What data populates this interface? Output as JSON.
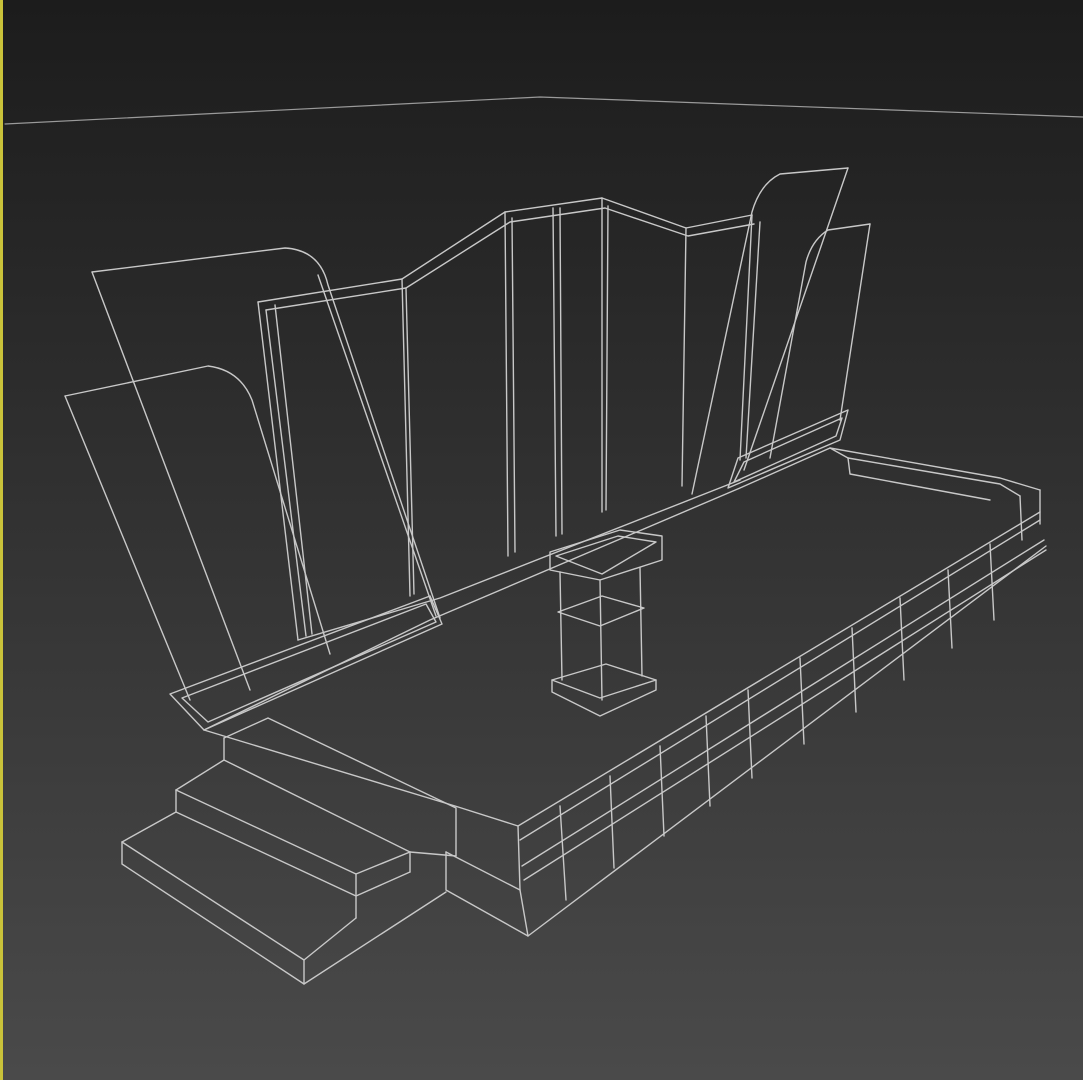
{
  "viewport": {
    "mode": "wireframe",
    "active": true,
    "colors": {
      "background_top": "#1c1c1c",
      "background_bottom": "#4a4a4a",
      "wire": "#c8c8c8",
      "wire_dim": "#9a9a9a",
      "active_border": "#c9c23a"
    }
  },
  "scene": {
    "objects": [
      {
        "name": "horizon-line"
      },
      {
        "name": "back-wall-panels"
      },
      {
        "name": "left-fin-panels"
      },
      {
        "name": "right-fin-panels"
      },
      {
        "name": "stage-platform"
      },
      {
        "name": "stage-front-edge"
      },
      {
        "name": "stage-steps"
      },
      {
        "name": "podium"
      },
      {
        "name": "floor-light-left"
      },
      {
        "name": "floor-light-right"
      }
    ]
  }
}
